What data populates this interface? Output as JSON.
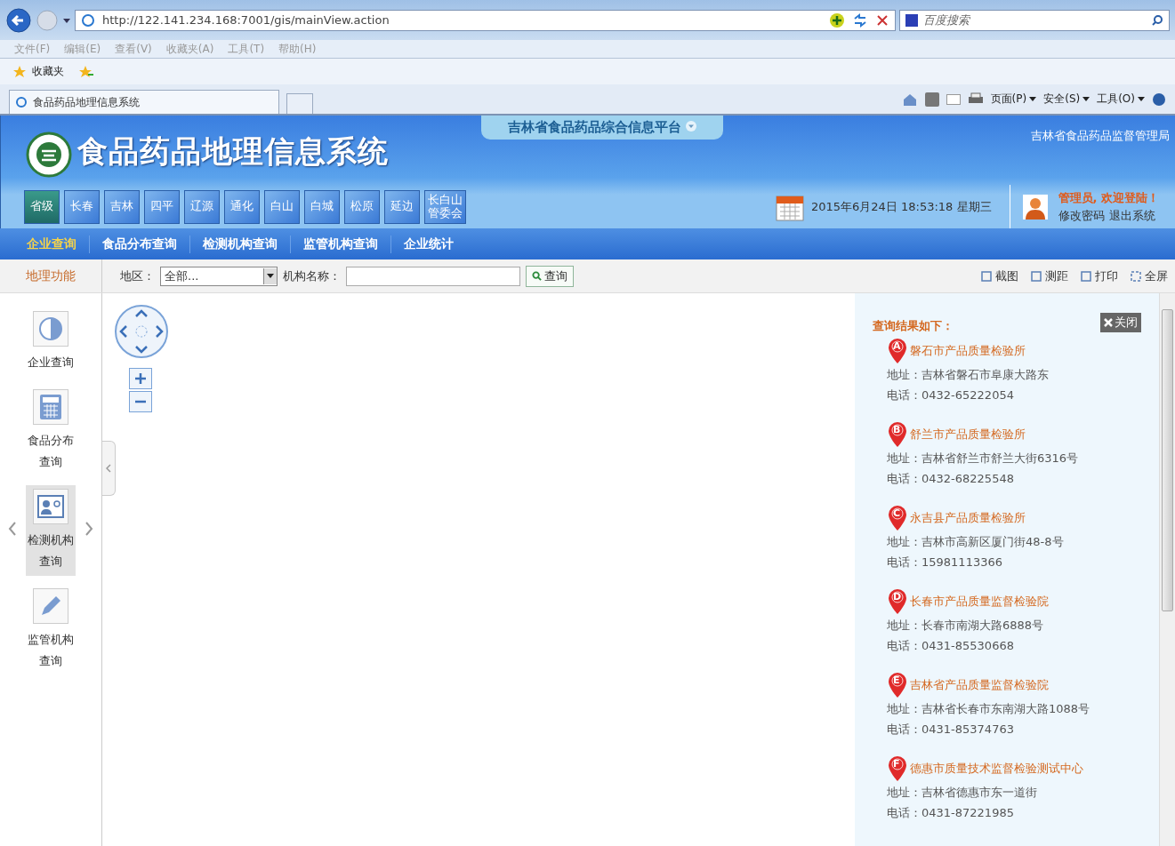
{
  "browser": {
    "url": "http://122.141.234.168:7001/gis/mainView.action",
    "search_placeholder": "百度搜索",
    "menu": [
      "文件(F)",
      "编辑(E)",
      "查看(V)",
      "收藏夹(A)",
      "工具(T)",
      "帮助(H)"
    ],
    "favorites_label": "收藏夹",
    "tab_title": "食品药品地理信息系统",
    "commands": [
      "页面(P)",
      "安全(S)",
      "工具(O)"
    ]
  },
  "header": {
    "platform_title": "吉林省食品药品综合信息平台",
    "system_title": "食品药品地理信息系统",
    "agency": "吉林省食品药品监督管理局",
    "datetime": "2015年6月24日 18:53:18 星期三",
    "welcome": "管理员, 欢迎登陆！",
    "links": [
      "修改密码",
      "退出系统"
    ],
    "regions": [
      {
        "label": "省级",
        "selected": true
      },
      {
        "label": "长春",
        "selected": false
      },
      {
        "label": "吉林",
        "selected": false
      },
      {
        "label": "四平",
        "selected": false
      },
      {
        "label": "辽源",
        "selected": false
      },
      {
        "label": "通化",
        "selected": false
      },
      {
        "label": "白山",
        "selected": false
      },
      {
        "label": "白城",
        "selected": false
      },
      {
        "label": "松原",
        "selected": false
      },
      {
        "label": "延边",
        "selected": false
      },
      {
        "label": "长白山管委会",
        "selected": false
      }
    ]
  },
  "nav": [
    {
      "label": "企业查询",
      "selected": true
    },
    {
      "label": "食品分布查询",
      "selected": false
    },
    {
      "label": "检测机构查询",
      "selected": false
    },
    {
      "label": "监管机构查询",
      "selected": false
    },
    {
      "label": "企业统计",
      "selected": false
    }
  ],
  "sidebar": {
    "title": "地理功能",
    "items": [
      {
        "label": "企业查询",
        "selected": false
      },
      {
        "label": "食品分布查询",
        "selected": false
      },
      {
        "label": "检测机构查询",
        "selected": true
      },
      {
        "label": "监管机构查询",
        "selected": false
      }
    ]
  },
  "filter": {
    "region_label": "地区：",
    "region_value": "全部...",
    "name_label": "机构名称：",
    "search_button": "查询"
  },
  "tools": [
    "截图",
    "测距",
    "打印",
    "全屏"
  ],
  "results": {
    "title": "查询结果如下：",
    "close": "关闭",
    "items": [
      {
        "marker": "A",
        "name": "磐石市产品质量检验所",
        "address": "地址：吉林省磐石市阜康大路东",
        "phone": "电话：0432-65222054"
      },
      {
        "marker": "B",
        "name": "舒兰市产品质量检验所",
        "address": "地址：吉林省舒兰市舒兰大街6316号",
        "phone": "电话：0432-68225548"
      },
      {
        "marker": "C",
        "name": "永吉县产品质量检验所",
        "address": "地址：吉林市高新区厦门街48-8号",
        "phone": "电话：15981113366"
      },
      {
        "marker": "D",
        "name": "长春市产品质量监督检验院",
        "address": "地址：长春市南湖大路6888号",
        "phone": "电话：0431-85530668"
      },
      {
        "marker": "E",
        "name": "吉林省产品质量监督检验院",
        "address": "地址：吉林省长春市东南湖大路1088号",
        "phone": "电话：0431-85374763"
      },
      {
        "marker": "F",
        "name": "德惠市质量技术监督检验测试中心",
        "address": "地址：吉林省德惠市东一道街",
        "phone": "电话：0431-87221985"
      }
    ]
  }
}
